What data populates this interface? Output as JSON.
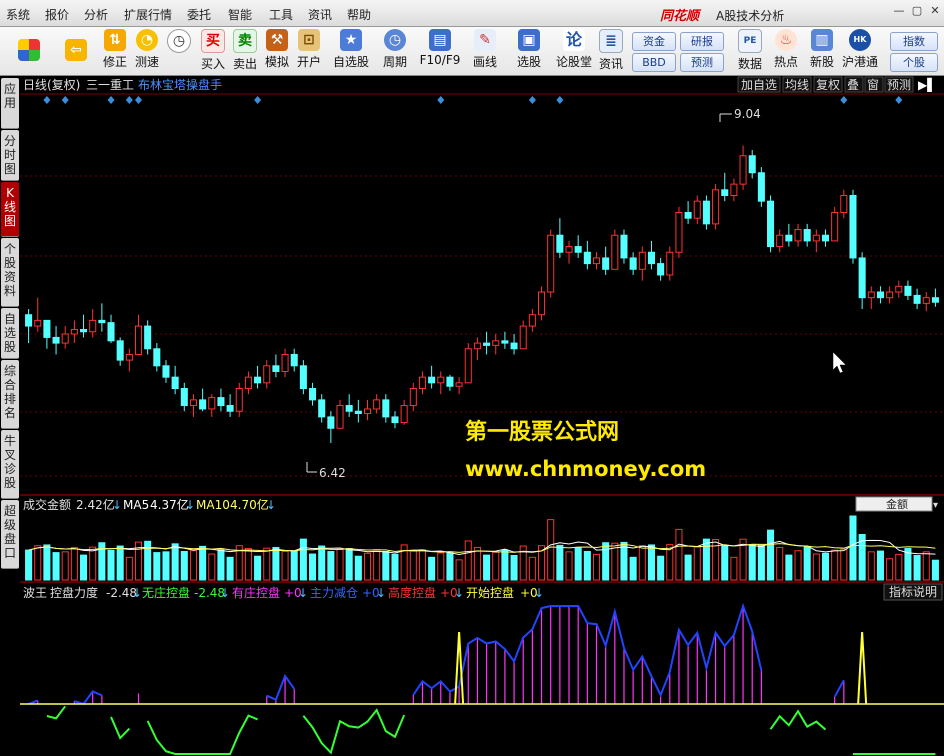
{
  "menubar": {
    "items": [
      "系统",
      "报价",
      "分析",
      "扩展行情",
      "委托",
      "智能",
      "工具",
      "资讯",
      "帮助"
    ],
    "brand": "同花顺",
    "window_title": "A股技术分析"
  },
  "toolbar": {
    "buttons": [
      {
        "label": "",
        "icon": "color-grid-icon"
      },
      {
        "label": "",
        "icon": "back-arrow-icon"
      },
      {
        "label": "修正",
        "icon": "arrows-icon"
      },
      {
        "label": "测速",
        "icon": "speed-icon"
      },
      {
        "label": "买入",
        "icon": "buy-icon"
      },
      {
        "label": "卖出",
        "icon": "sell-icon"
      },
      {
        "label": "模拟",
        "icon": "hammer-icon"
      },
      {
        "label": "开户",
        "icon": "lock-icon"
      },
      {
        "label": "自选股",
        "icon": "star-folder-icon"
      },
      {
        "label": "周期",
        "icon": "clock-icon"
      },
      {
        "label": "F10/F9",
        "icon": "doc-icon"
      },
      {
        "label": "画线",
        "icon": "pencil-icon"
      },
      {
        "label": "选股",
        "icon": "select-icon"
      },
      {
        "label": "论股堂",
        "icon": "forum-icon"
      },
      {
        "label": "资讯",
        "icon": "news-icon"
      },
      {
        "label": "数据",
        "icon": "pe-icon"
      },
      {
        "label": "热点",
        "icon": "hot-icon"
      },
      {
        "label": "新股",
        "icon": "new-stock-icon"
      },
      {
        "label": "沪港通",
        "icon": "hk-icon"
      }
    ],
    "pills": {
      "fund": "资金",
      "research": "研报",
      "bbd": "BBD",
      "forecast": "预测",
      "index": "指数",
      "stock": "个股"
    }
  },
  "left_tabs": [
    "应用",
    "分时图",
    "K线图",
    "个股资料",
    "自选股",
    "综合排名",
    "牛叉诊股",
    "超级盘口"
  ],
  "chart_header": {
    "period": "日线(复权)",
    "stock": "三一重工",
    "indicator": "布林宝塔操盘手",
    "buttons": [
      "加自选",
      "均线",
      "复权",
      "叠",
      "窗",
      "预测"
    ]
  },
  "chart_data": [
    {
      "type": "candlestick",
      "name": "price",
      "high_label": "9.04",
      "low_label": "6.42",
      "ylim": [
        6.2,
        9.3
      ],
      "ohlc": [
        [
          7.55,
          7.6,
          7.3,
          7.45
        ],
        [
          7.45,
          7.7,
          7.4,
          7.5
        ],
        [
          7.5,
          7.5,
          7.25,
          7.35
        ],
        [
          7.35,
          7.45,
          7.2,
          7.3
        ],
        [
          7.3,
          7.45,
          7.25,
          7.38
        ],
        [
          7.38,
          7.5,
          7.3,
          7.42
        ],
        [
          7.42,
          7.55,
          7.35,
          7.4
        ],
        [
          7.4,
          7.6,
          7.35,
          7.5
        ],
        [
          7.5,
          7.65,
          7.4,
          7.48
        ],
        [
          7.48,
          7.55,
          7.3,
          7.32
        ],
        [
          7.32,
          7.35,
          7.1,
          7.15
        ],
        [
          7.15,
          7.25,
          7.05,
          7.2
        ],
        [
          7.2,
          7.55,
          7.2,
          7.45
        ],
        [
          7.45,
          7.5,
          7.2,
          7.25
        ],
        [
          7.25,
          7.3,
          7.05,
          7.1
        ],
        [
          7.1,
          7.15,
          6.95,
          7.0
        ],
        [
          7.0,
          7.1,
          6.85,
          6.9
        ],
        [
          6.9,
          6.95,
          6.7,
          6.75
        ],
        [
          6.75,
          6.85,
          6.65,
          6.8
        ],
        [
          6.8,
          6.9,
          6.7,
          6.72
        ],
        [
          6.72,
          6.85,
          6.65,
          6.82
        ],
        [
          6.82,
          6.9,
          6.7,
          6.75
        ],
        [
          6.75,
          6.85,
          6.65,
          6.7
        ],
        [
          6.7,
          6.95,
          6.65,
          6.9
        ],
        [
          6.9,
          7.05,
          6.85,
          7.0
        ],
        [
          7.0,
          7.1,
          6.9,
          6.95
        ],
        [
          6.95,
          7.15,
          6.9,
          7.1
        ],
        [
          7.1,
          7.2,
          7.0,
          7.05
        ],
        [
          7.05,
          7.25,
          7.0,
          7.2
        ],
        [
          7.2,
          7.25,
          7.05,
          7.1
        ],
        [
          7.1,
          7.15,
          6.85,
          6.9
        ],
        [
          6.9,
          6.95,
          6.75,
          6.8
        ],
        [
          6.8,
          6.85,
          6.6,
          6.65
        ],
        [
          6.65,
          6.7,
          6.42,
          6.55
        ],
        [
          6.55,
          6.8,
          6.55,
          6.75
        ],
        [
          6.75,
          6.85,
          6.65,
          6.7
        ],
        [
          6.7,
          6.8,
          6.6,
          6.68
        ],
        [
          6.68,
          6.8,
          6.62,
          6.72
        ],
        [
          6.72,
          6.85,
          6.68,
          6.8
        ],
        [
          6.8,
          6.85,
          6.6,
          6.65
        ],
        [
          6.65,
          6.7,
          6.55,
          6.6
        ],
        [
          6.6,
          6.8,
          6.58,
          6.75
        ],
        [
          6.75,
          6.95,
          6.7,
          6.9
        ],
        [
          6.9,
          7.05,
          6.85,
          7.0
        ],
        [
          7.0,
          7.1,
          6.9,
          6.95
        ],
        [
          6.95,
          7.05,
          6.85,
          7.0
        ],
        [
          7.0,
          7.02,
          6.88,
          6.92
        ],
        [
          6.92,
          7.0,
          6.85,
          6.95
        ],
        [
          6.95,
          7.3,
          6.95,
          7.25
        ],
        [
          7.25,
          7.35,
          7.15,
          7.3
        ],
        [
          7.3,
          7.4,
          7.2,
          7.28
        ],
        [
          7.28,
          7.38,
          7.2,
          7.32
        ],
        [
          7.32,
          7.4,
          7.25,
          7.3
        ],
        [
          7.3,
          7.38,
          7.2,
          7.25
        ],
        [
          7.25,
          7.5,
          7.25,
          7.45
        ],
        [
          7.45,
          7.6,
          7.4,
          7.55
        ],
        [
          7.55,
          7.8,
          7.5,
          7.75
        ],
        [
          7.75,
          8.3,
          7.7,
          8.25
        ],
        [
          8.25,
          8.4,
          8.05,
          8.1
        ],
        [
          8.1,
          8.2,
          8.0,
          8.15
        ],
        [
          8.15,
          8.25,
          8.05,
          8.1
        ],
        [
          8.1,
          8.2,
          7.95,
          8.0
        ],
        [
          8.0,
          8.1,
          7.95,
          8.05
        ],
        [
          8.05,
          8.15,
          7.9,
          7.95
        ],
        [
          7.95,
          8.3,
          7.95,
          8.25
        ],
        [
          8.25,
          8.3,
          8.0,
          8.05
        ],
        [
          8.05,
          8.1,
          7.9,
          7.95
        ],
        [
          7.95,
          8.15,
          7.85,
          8.1
        ],
        [
          8.1,
          8.2,
          7.95,
          8.0
        ],
        [
          8.0,
          8.05,
          7.85,
          7.9
        ],
        [
          7.9,
          8.15,
          7.85,
          8.1
        ],
        [
          8.1,
          8.5,
          8.05,
          8.45
        ],
        [
          8.45,
          8.55,
          8.35,
          8.4
        ],
        [
          8.4,
          8.6,
          8.35,
          8.55
        ],
        [
          8.55,
          8.6,
          8.3,
          8.35
        ],
        [
          8.35,
          8.7,
          8.3,
          8.65
        ],
        [
          8.65,
          8.8,
          8.55,
          8.6
        ],
        [
          8.6,
          8.75,
          8.55,
          8.7
        ],
        [
          8.7,
          9.04,
          8.65,
          8.95
        ],
        [
          8.95,
          9.0,
          8.75,
          8.8
        ],
        [
          8.8,
          8.85,
          8.5,
          8.55
        ],
        [
          8.55,
          8.6,
          8.1,
          8.15
        ],
        [
          8.15,
          8.3,
          8.1,
          8.25
        ],
        [
          8.25,
          8.35,
          8.15,
          8.2
        ],
        [
          8.2,
          8.35,
          8.15,
          8.3
        ],
        [
          8.3,
          8.35,
          8.15,
          8.2
        ],
        [
          8.2,
          8.3,
          8.1,
          8.25
        ],
        [
          8.25,
          8.3,
          8.15,
          8.2
        ],
        [
          8.2,
          8.5,
          8.2,
          8.45
        ],
        [
          8.45,
          8.65,
          8.4,
          8.6
        ],
        [
          8.6,
          8.65,
          8.0,
          8.05
        ],
        [
          8.05,
          8.1,
          7.6,
          7.7
        ],
        [
          7.7,
          7.8,
          7.6,
          7.75
        ],
        [
          7.75,
          7.8,
          7.65,
          7.7
        ],
        [
          7.7,
          7.8,
          7.65,
          7.75
        ],
        [
          7.75,
          7.85,
          7.7,
          7.8
        ],
        [
          7.8,
          7.85,
          7.68,
          7.72
        ],
        [
          7.72,
          7.78,
          7.6,
          7.65
        ],
        [
          7.65,
          7.75,
          7.58,
          7.7
        ],
        [
          7.7,
          7.78,
          7.62,
          7.66
        ]
      ]
    },
    {
      "type": "bar",
      "name": "volume",
      "legend": {
        "label": "成交金额",
        "value": "2.42亿",
        "ma5_label": "MA5",
        "ma5": "4.37亿",
        "ma10_label": "MA10",
        "ma10": "4.70亿"
      },
      "dropdown": "金额"
    },
    {
      "type": "line",
      "name": "oscillator",
      "legend": [
        {
          "name": "波王",
          "label": "控盘力度",
          "value": "-2.48",
          "color": "#ffffff"
        },
        {
          "name": "无庄控盘",
          "value": "-2.48",
          "color": "#33ff33"
        },
        {
          "name": "有庄控盘",
          "value": "+0",
          "color": "#ff33ff"
        },
        {
          "name": "主力减仓",
          "value": "+0",
          "color": "#3366ff"
        },
        {
          "name": "高度控盘",
          "value": "+0",
          "color": "#ff3333"
        },
        {
          "name": "开始控盘",
          "value": "+0",
          "color": "#ffff33"
        }
      ],
      "help_button": "指标说明"
    }
  ],
  "watermark": {
    "line1": "第一股票公式网",
    "line2": "www.chnmoney.com"
  },
  "colors": {
    "up": "#ff3232",
    "down": "#54ffff",
    "bg": "#000000",
    "grid": "#7a0000"
  }
}
